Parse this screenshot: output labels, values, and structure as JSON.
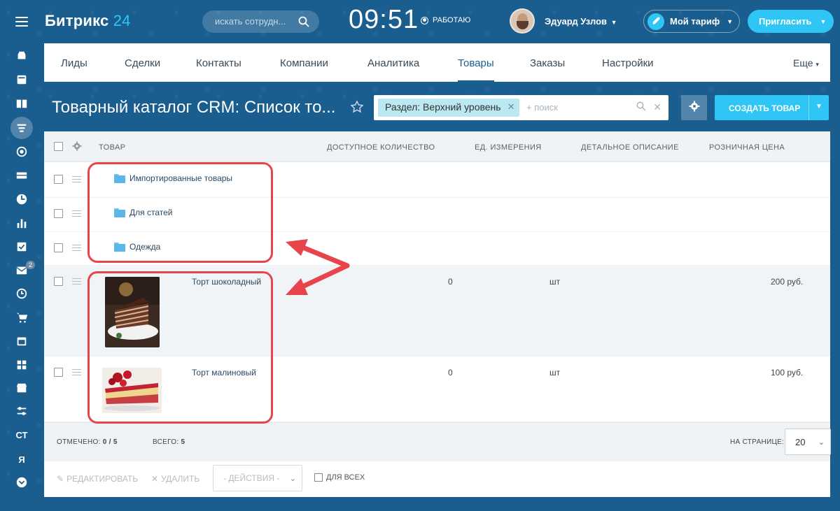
{
  "header": {
    "logo_text": "Битрикс",
    "logo_num": "24",
    "search_placeholder": "искать сотрудн...",
    "clock": "09:51",
    "work_status": "РАБОТАЮ",
    "user_name": "Эдуард Узлов",
    "tariff_label": "Мой тариф",
    "invite_label": "Пригласить"
  },
  "sidebar": {
    "items": [
      "android-icon",
      "feed-icon",
      "book-icon",
      "filter-icon",
      "target-icon",
      "drive-icon",
      "clock-icon",
      "chart-icon",
      "tasks-icon",
      "mail-icon",
      "time-icon",
      "cart-icon",
      "calendar-icon",
      "apps-icon",
      "shop-icon",
      "settings-icon",
      "СТ",
      "Я",
      "more-icon"
    ],
    "mail_badge": "2"
  },
  "nav": {
    "tabs": [
      "Лиды",
      "Сделки",
      "Контакты",
      "Компании",
      "Аналитика",
      "Товары",
      "Заказы",
      "Настройки"
    ],
    "active": "Товары",
    "more": "Еще"
  },
  "toolbar": {
    "title": "Товарный каталог CRM: Список то...",
    "filter_chip": "Раздел: Верхний уровень",
    "filter_placeholder": "+ поиск",
    "create_label": "СОЗДАТЬ ТОВАР"
  },
  "grid": {
    "columns": [
      "ТОВАР",
      "ДОСТУПНОЕ КОЛИЧЕСТВО",
      "ЕД. ИЗМЕРЕНИЯ",
      "ДЕТАЛЬНОЕ ОПИСАНИЕ",
      "РОЗНИЧНАЯ ЦЕНА"
    ],
    "folders": [
      "Импортированные товары",
      "Для статей",
      "Одежда"
    ],
    "products": [
      {
        "name": "Торт шоколадный",
        "qty": "0",
        "unit": "шт",
        "price": "200 руб."
      },
      {
        "name": "Торт малиновый",
        "qty": "0",
        "unit": "шт",
        "price": "100 руб."
      }
    ]
  },
  "footer": {
    "checked_label": "ОТМЕЧЕНО:",
    "checked_value": "0 / 5",
    "total_label": "ВСЕГО:",
    "total_value": "5",
    "per_page_label": "НА СТРАНИЦЕ:",
    "per_page_value": "20",
    "edit_label": "РЕДАКТИРОВАТЬ",
    "delete_label": "УДАЛИТЬ",
    "actions_label": "- ДЕЙСТВИЯ -",
    "for_all_label": "ДЛЯ ВСЕХ"
  },
  "colors": {
    "background": "#1a5d8f",
    "accent": "#2fc6f6",
    "annotation": "#e8444b"
  }
}
